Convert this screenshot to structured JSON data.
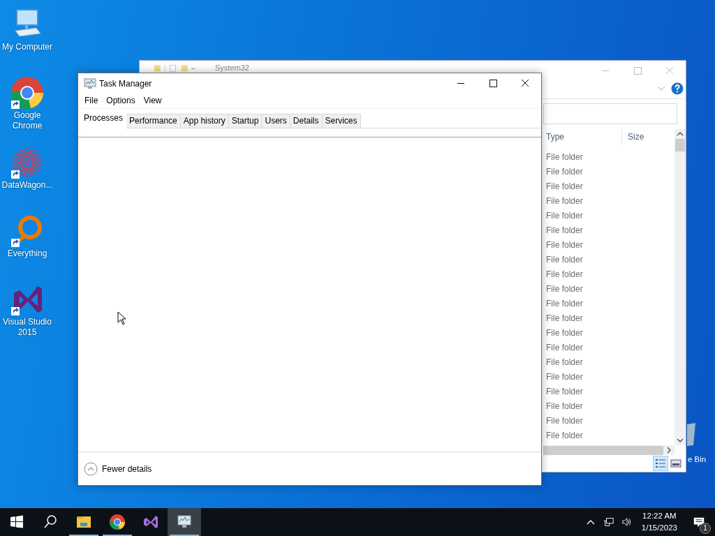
{
  "desktop_icons": [
    {
      "kind": "computer",
      "label": "My Computer",
      "shortcut": false
    },
    {
      "kind": "chrome",
      "label": "Google Chrome",
      "shortcut": true
    },
    {
      "kind": "datawagon",
      "label": "DataWagon...",
      "shortcut": true
    },
    {
      "kind": "everything",
      "label": "Everything",
      "shortcut": true
    },
    {
      "kind": "vs",
      "label": "Visual Studio 2015",
      "shortcut": true
    }
  ],
  "recycle_bin": {
    "label": "e Bin"
  },
  "explorer": {
    "title": "System32",
    "columns": [
      "Type",
      "Size"
    ],
    "rows": [
      "File folder",
      "File folder",
      "File folder",
      "File folder",
      "File folder",
      "File folder",
      "File folder",
      "File folder",
      "File folder",
      "File folder",
      "File folder",
      "File folder",
      "File folder",
      "File folder",
      "File folder",
      "File folder",
      "File folder",
      "File folder",
      "File folder",
      "File folder"
    ]
  },
  "task_manager": {
    "title": "Task Manager",
    "menu": [
      "File",
      "Options",
      "View"
    ],
    "tabs": [
      {
        "label": "Processes",
        "selected": true
      },
      {
        "label": "Performance",
        "selected": false
      },
      {
        "label": "App history",
        "selected": false
      },
      {
        "label": "Startup",
        "selected": false
      },
      {
        "label": "Users",
        "selected": false
      },
      {
        "label": "Details",
        "selected": false
      },
      {
        "label": "Services",
        "selected": false
      }
    ],
    "footer": "Fewer details"
  },
  "taskbar": {
    "apps": [
      {
        "kind": "start",
        "running": false,
        "selected": false
      },
      {
        "kind": "search",
        "running": false,
        "selected": false
      },
      {
        "kind": "explorer",
        "running": true,
        "selected": false
      },
      {
        "kind": "chrome",
        "running": true,
        "selected": false
      },
      {
        "kind": "vs",
        "running": false,
        "selected": false
      },
      {
        "kind": "taskmgr",
        "running": true,
        "selected": true
      }
    ],
    "clock": {
      "time": "12:22 AM",
      "date": "1/15/2023"
    },
    "notifications": {
      "count": "1"
    }
  }
}
